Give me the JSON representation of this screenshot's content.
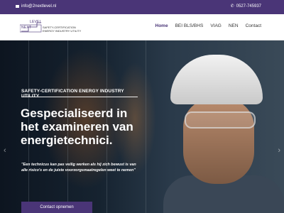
{
  "topbar": {
    "email": "info@2nextlevel.nl",
    "phone": "0527-745937"
  },
  "logo": {
    "word1": "NEXT",
    "word2": "LEVEL",
    "tagline1": "SAFETY-CERTIFICATION",
    "tagline2": "ENERGY INDUSTRY UTILITY"
  },
  "nav": {
    "items": [
      {
        "label": "Home"
      },
      {
        "label": "BEI BLS/BHS"
      },
      {
        "label": "VIAG"
      },
      {
        "label": "NEN"
      },
      {
        "label": "Contact"
      }
    ]
  },
  "hero": {
    "subtitle": "SAFETY-CERTIFICATION ENERGY INDUSTRY UTILITY",
    "headline": "Gespecialiseerd in het examineren van energietechnici.",
    "quote": "\"Een technicus kan pas veilig werken als hij zich bewust is van alle risico's en de juiste voorzorgsmaatregelen weet te nemen\"",
    "cta_label": "Contact opnemen"
  },
  "colors": {
    "brand": "#4a3577"
  },
  "icons": {
    "email": "envelope-icon",
    "phone": "phone-icon",
    "prev": "chevron-left-icon",
    "next": "chevron-right-icon"
  }
}
